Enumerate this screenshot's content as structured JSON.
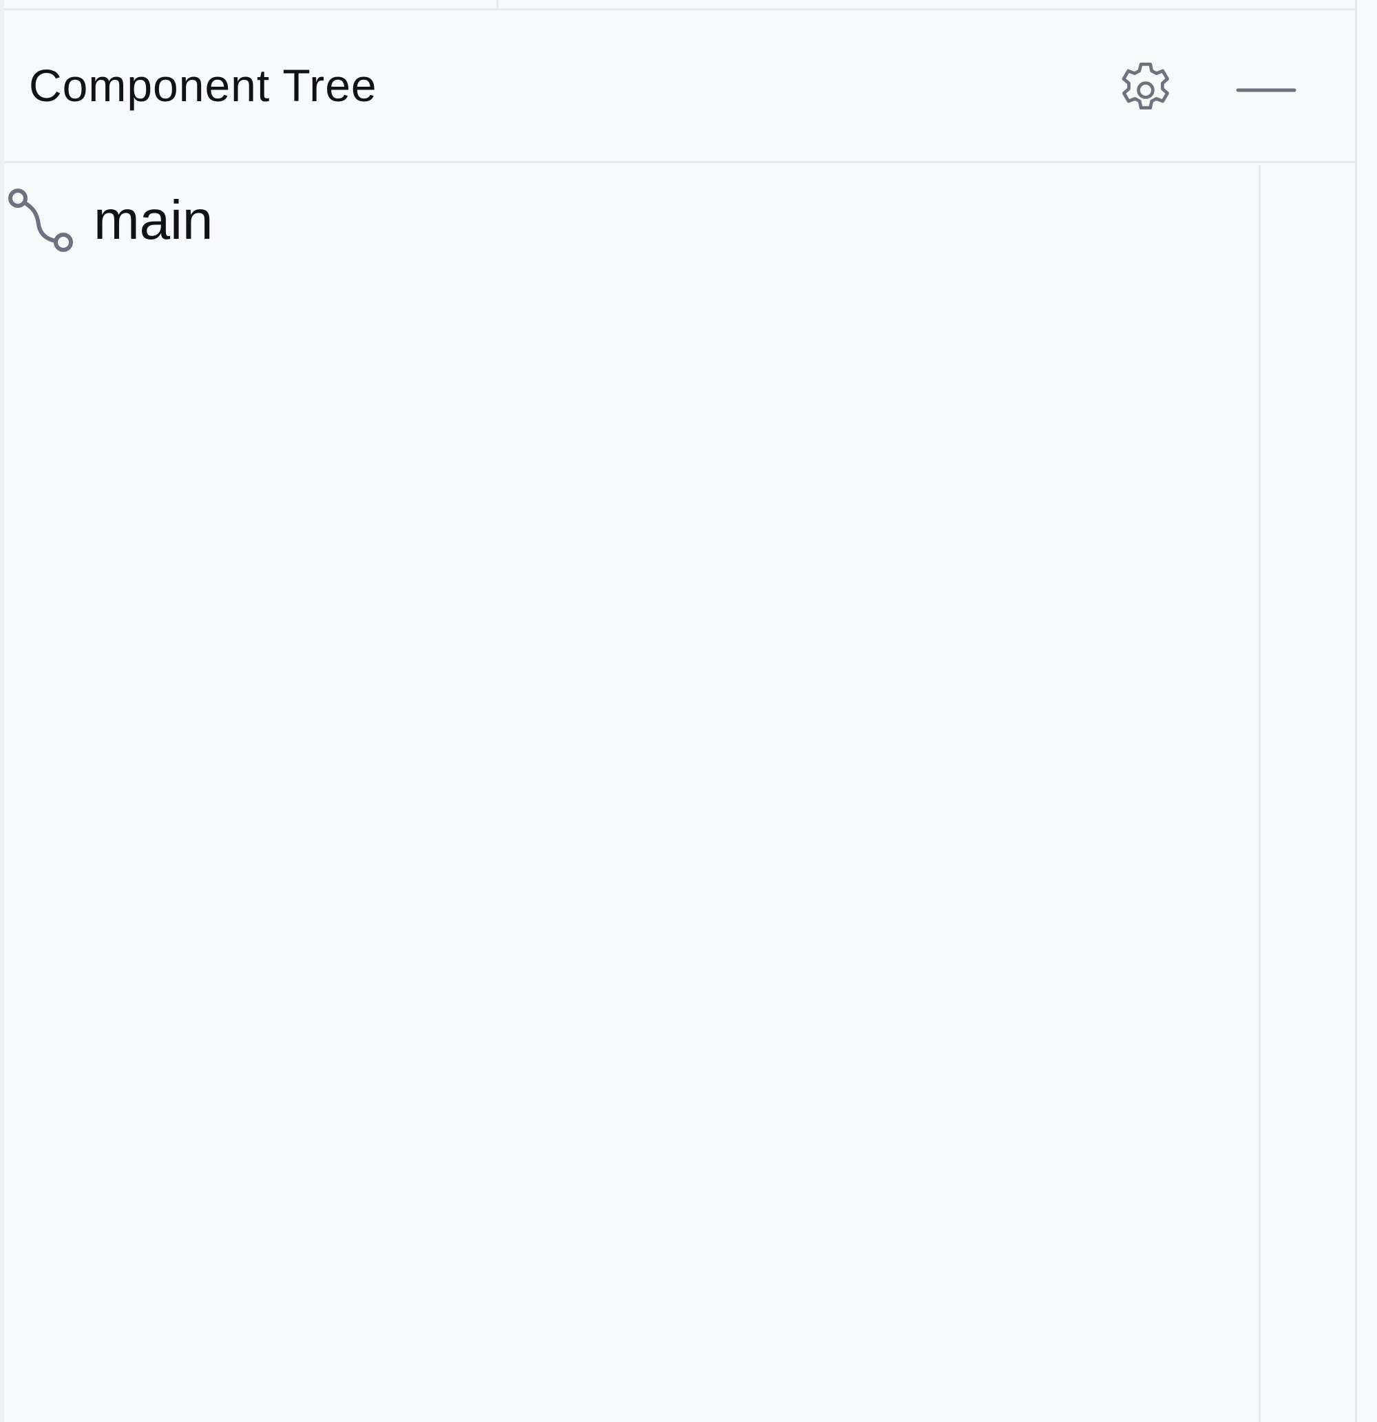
{
  "panel": {
    "title": "Component Tree",
    "icons": {
      "settings": "gear-icon",
      "minimize": "minimize-icon"
    }
  },
  "tree": {
    "items": [
      {
        "label": "main",
        "icon": "branch-icon"
      }
    ]
  },
  "colors": {
    "background": "#f7f8fa",
    "border": "#e6e8ec",
    "text": "#111213",
    "icon": "#6e7180"
  }
}
